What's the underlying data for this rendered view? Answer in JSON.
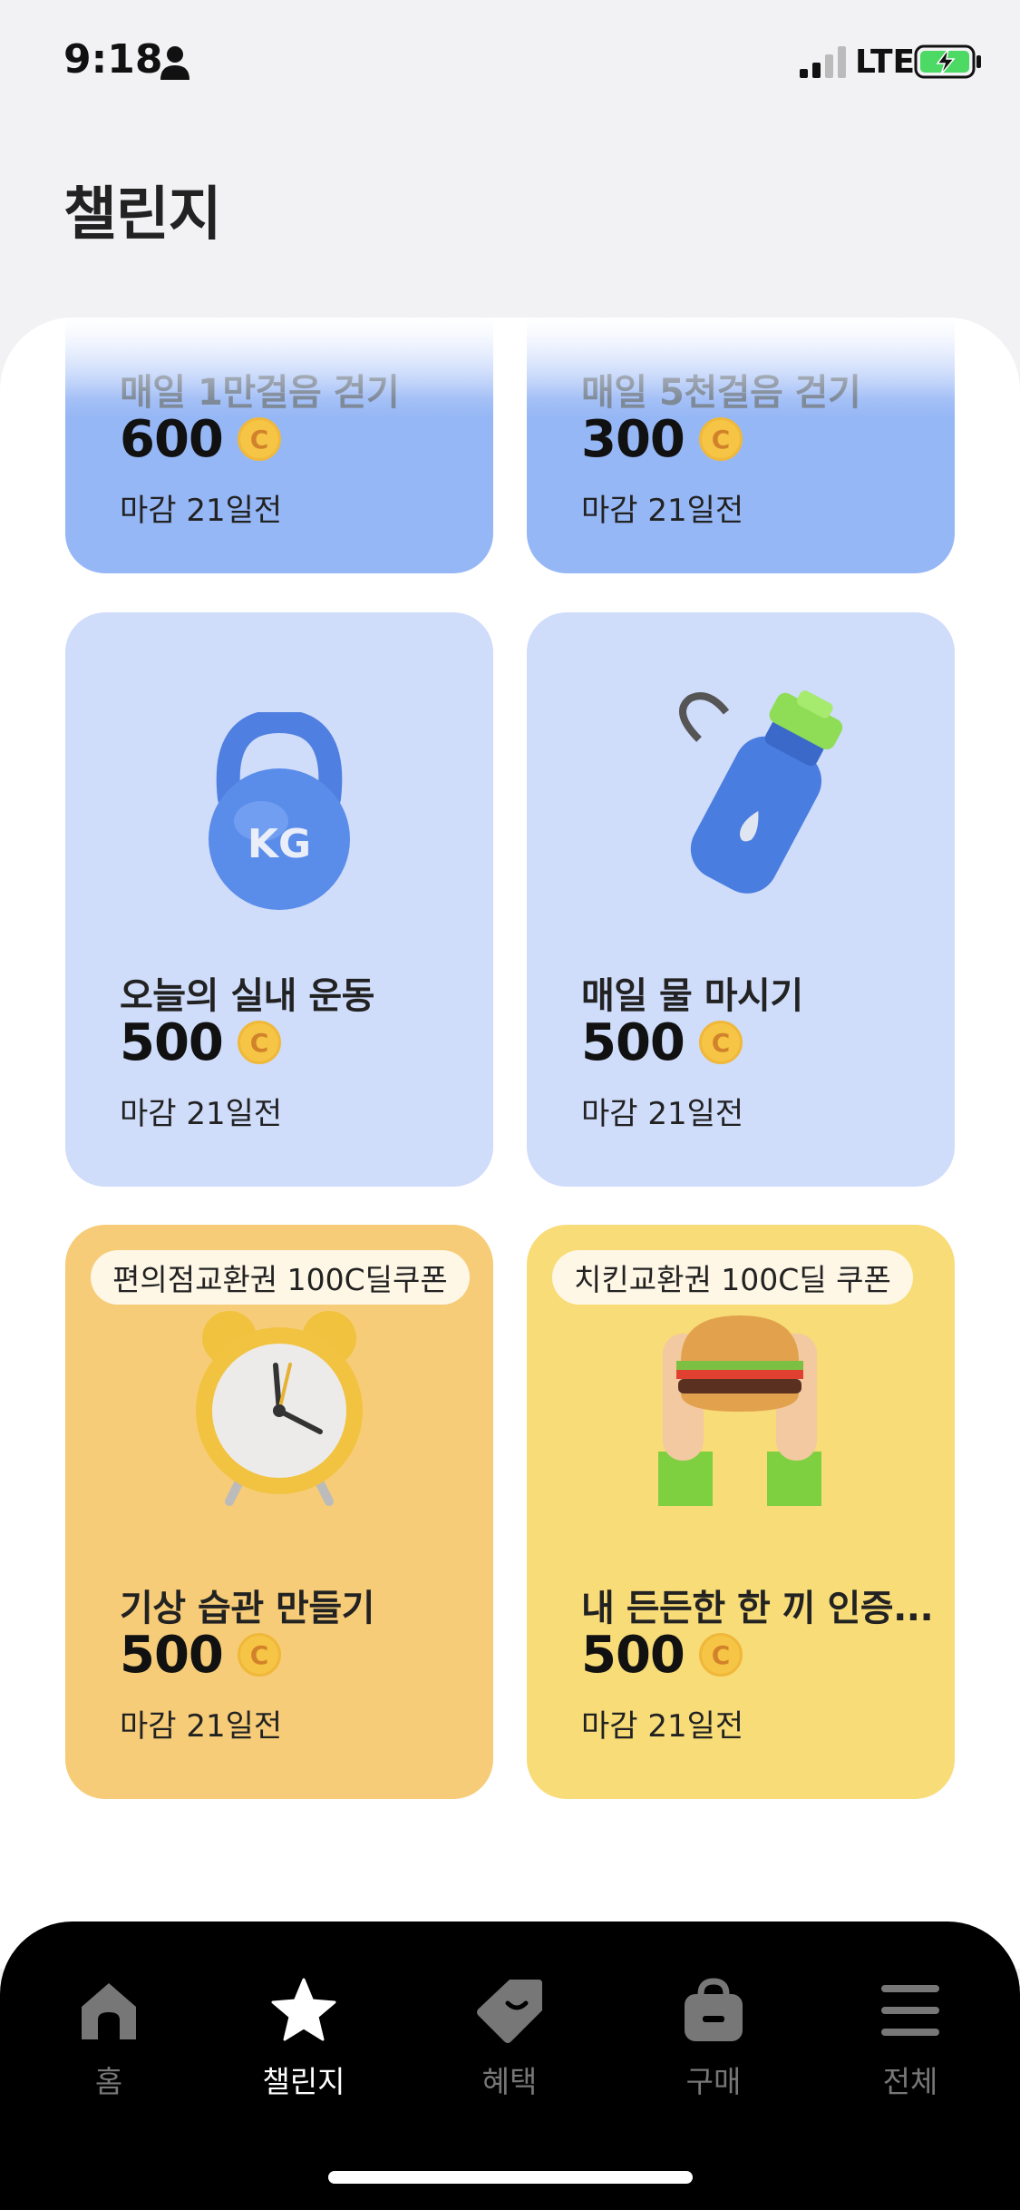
{
  "status_bar": {
    "time": "9:18",
    "network": "LTE"
  },
  "page": {
    "title": "챌린지"
  },
  "challenges": [
    {
      "title": "매일 1만걸음 걷기",
      "points": "600",
      "coin_symbol": "C",
      "deadline": "마감 21일전"
    },
    {
      "title": "매일 5천걸음 걷기",
      "points": "300",
      "coin_symbol": "C",
      "deadline": "마감 21일전"
    },
    {
      "title": "오늘의 실내 운동",
      "points": "500",
      "coin_symbol": "C",
      "deadline": "마감 21일전",
      "image_text": "KG"
    },
    {
      "title": "매일 물 마시기",
      "points": "500",
      "coin_symbol": "C",
      "deadline": "마감 21일전"
    },
    {
      "title": "기상 습관 만들기",
      "points": "500",
      "coin_symbol": "C",
      "deadline": "마감 21일전",
      "badge": "편의점교환권 100C딜쿠폰"
    },
    {
      "title": "내 든든한 한 끼 인증...",
      "points": "500",
      "coin_symbol": "C",
      "deadline": "마감 21일전",
      "badge": "치킨교환권 100C딜 쿠폰"
    }
  ],
  "bottom_nav": [
    {
      "label": "홈",
      "icon": "home-icon",
      "active": false
    },
    {
      "label": "챌린지",
      "icon": "star-icon",
      "active": true
    },
    {
      "label": "혜택",
      "icon": "tag-icon",
      "active": false
    },
    {
      "label": "구매",
      "icon": "shopping-bag-icon",
      "active": false
    },
    {
      "label": "전체",
      "icon": "menu-icon",
      "active": false
    }
  ],
  "colors": {
    "background": "#f2f2f5",
    "card_blue": "#96b7f5",
    "card_light_blue": "#cfdcfa",
    "card_orange": "#f6cc78",
    "card_yellow": "#f8dc78",
    "coin": "#f6c545",
    "nav_background": "#000000"
  }
}
